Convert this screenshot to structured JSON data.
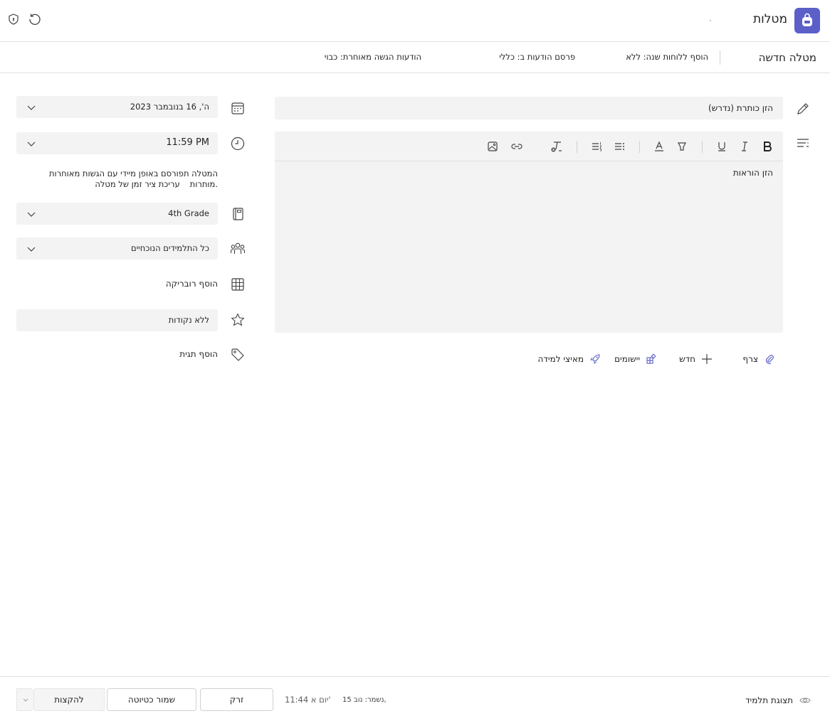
{
  "app": {
    "title": "מטלות",
    "brand_color": "#5b5fc7",
    "icons": [
      "backpack-icon",
      "refresh-icon",
      "shield-icon"
    ]
  },
  "subheader": {
    "page_title": "מטלה חדשה",
    "gradebook": "הוסף ללוחות שנה: ללא",
    "publish": "פרסם הודעות ב: כללי",
    "late": "הודעות הגשה מאוחרת: כבוי"
  },
  "form": {
    "title_placeholder": "הזן כותרת (נדרש)",
    "instructions_placeholder": "הזן הוראות",
    "due_date": "ה', 16 בנובמבר 2023",
    "due_time": "11:59 PM",
    "schedule_note_1": "המטלה תפורסם באופן מיידי עם הגשות מאוחרות",
    "schedule_note_2": "מותרות.",
    "schedule_link": "עריכת ציר זמן של מטלה",
    "class": "4th Grade",
    "students": "כל התלמידים הנוכחיים",
    "rubric": "הוסף רובריקה",
    "points": "ללא נקודות",
    "tag": "הוסף תגית"
  },
  "attach": {
    "attach_label": "צרף",
    "new_label": "חדש",
    "apps_label": "יישומים",
    "learning_label": "מאיצי למידה"
  },
  "toolbar": {
    "icons": [
      "bold-icon",
      "italic-icon",
      "underline-icon",
      "highlight-icon",
      "font-color-icon",
      "bullet-list-icon",
      "numbered-list-icon",
      "clear-format-icon",
      "link-icon",
      "image-icon"
    ]
  },
  "footer": {
    "assign_label": "להקצות",
    "save_draft_label": "שמור כטיוטה",
    "discard_label": "זרק",
    "time": "11:44 יום א'",
    "saved": "נשמר: נוב 15,",
    "student_view": "תצוגת תלמיד"
  }
}
